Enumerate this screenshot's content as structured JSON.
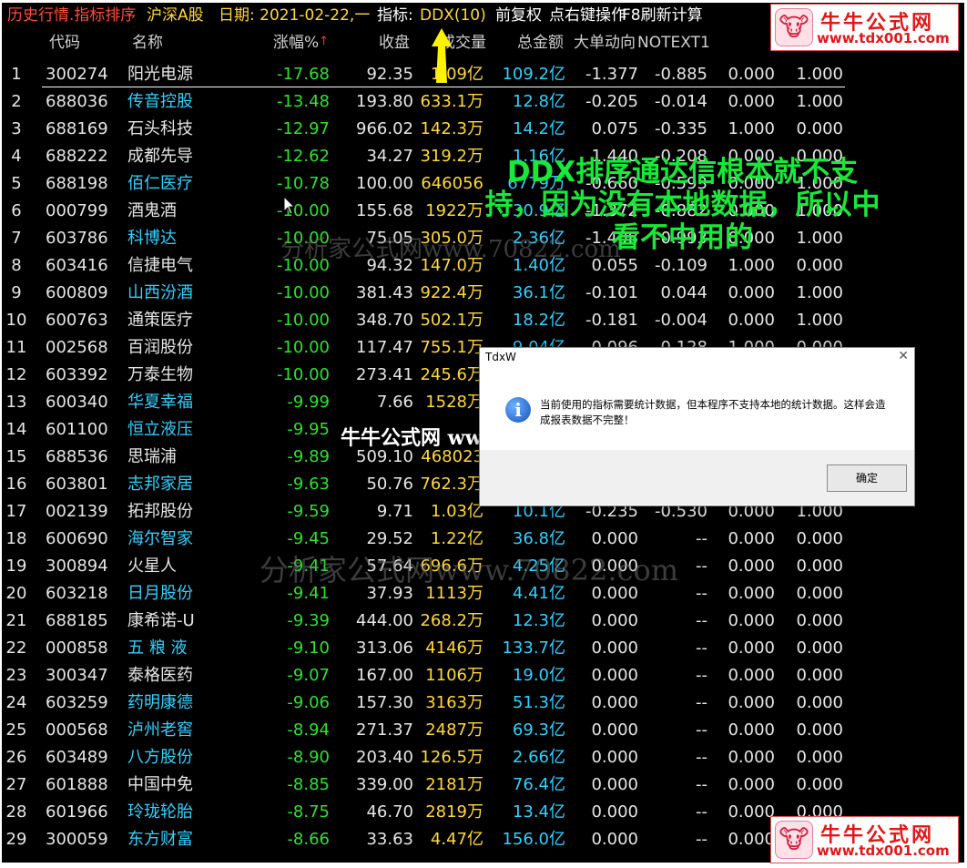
{
  "topbar": {
    "title": "历史行情.指标排序",
    "market": "沪深A股",
    "date": "日期: 2021-02-22,一",
    "indicator_label": "指标:",
    "indicator_value": "DDX(10)",
    "adjust": "前复权",
    "hint": "点右键操作",
    "f8": "F8刷新计算"
  },
  "columns": [
    "代码",
    "名称",
    "涨幅%",
    "收盘",
    "成交量",
    "总金额",
    "大单动向",
    "NOTEXT1"
  ],
  "sort_indicator": "↑",
  "rows": [
    {
      "idx": "1",
      "code": "300274",
      "name": "阳光电源",
      "cyan": false,
      "chg": "-17.68",
      "close": "92.35",
      "vol": "1.09亿",
      "amt": "109.2亿",
      "dd": "-1.377",
      "nt": "-0.885",
      "x1": "0.000",
      "x2": "1.000"
    },
    {
      "idx": "2",
      "code": "688036",
      "name": "传音控股",
      "cyan": true,
      "chg": "-13.48",
      "close": "193.80",
      "vol": "633.1万",
      "amt": "12.8亿",
      "dd": "-0.205",
      "nt": "-0.014",
      "x1": "0.000",
      "x2": "1.000"
    },
    {
      "idx": "3",
      "code": "688169",
      "name": "石头科技",
      "cyan": false,
      "chg": "-12.97",
      "close": "966.02",
      "vol": "142.3万",
      "amt": "14.2亿",
      "dd": "0.075",
      "nt": "-0.335",
      "x1": "1.000",
      "x2": "0.000"
    },
    {
      "idx": "4",
      "code": "688222",
      "name": "成都先导",
      "cyan": false,
      "chg": "-12.62",
      "close": "34.27",
      "vol": "319.2万",
      "amt": "1.16亿",
      "dd": "1.440",
      "nt": "-0.208",
      "x1": "0.000",
      "x2": "0.000"
    },
    {
      "idx": "5",
      "code": "688198",
      "name": "佰仁医疗",
      "cyan": true,
      "chg": "-10.78",
      "close": "100.00",
      "vol": "646056",
      "amt": "6779万",
      "dd": "-0.660",
      "nt": "-0.593",
      "x1": "0.000",
      "x2": "1.000"
    },
    {
      "idx": "6",
      "code": "000799",
      "name": "酒鬼酒",
      "cyan": false,
      "chg": "-10.00",
      "close": "155.68",
      "vol": "1922万",
      "amt": "30.9亿",
      "dd": "-1.372",
      "nt": "-0.882",
      "x1": "0.000",
      "x2": "1.000"
    },
    {
      "idx": "7",
      "code": "603786",
      "name": "科博达",
      "cyan": true,
      "chg": "-10.00",
      "close": "75.05",
      "vol": "305.0万",
      "amt": "2.36亿",
      "dd": "-1.408",
      "nt": "-0.993",
      "x1": "0.000",
      "x2": "1.000"
    },
    {
      "idx": "8",
      "code": "603416",
      "name": "信捷电气",
      "cyan": false,
      "chg": "-10.00",
      "close": "94.32",
      "vol": "147.0万",
      "amt": "1.40亿",
      "dd": "0.055",
      "nt": "-0.109",
      "x1": "1.000",
      "x2": "0.000"
    },
    {
      "idx": "9",
      "code": "600809",
      "name": "山西汾酒",
      "cyan": true,
      "chg": "-10.00",
      "close": "381.43",
      "vol": "922.4万",
      "amt": "36.1亿",
      "dd": "-0.101",
      "nt": "0.044",
      "x1": "0.000",
      "x2": "1.000"
    },
    {
      "idx": "10",
      "code": "600763",
      "name": "通策医疗",
      "cyan": false,
      "chg": "-10.00",
      "close": "348.70",
      "vol": "502.1万",
      "amt": "18.2亿",
      "dd": "-0.181",
      "nt": "-0.004",
      "x1": "0.000",
      "x2": "1.000"
    },
    {
      "idx": "11",
      "code": "002568",
      "name": "百润股份",
      "cyan": false,
      "chg": "-10.00",
      "close": "117.47",
      "vol": "755.1万",
      "amt": "9.04亿",
      "dd": "-0.096",
      "nt": "-0.128",
      "x1": "1.000",
      "x2": "0.000"
    },
    {
      "idx": "12",
      "code": "603392",
      "name": "万泰生物",
      "cyan": false,
      "chg": "-10.00",
      "close": "273.41",
      "vol": "245.6万",
      "amt": "",
      "dd": "",
      "nt": "",
      "x1": "",
      "x2": ""
    },
    {
      "idx": "13",
      "code": "600340",
      "name": "华夏幸福",
      "cyan": true,
      "chg": "-9.99",
      "close": "7.66",
      "vol": "1528万",
      "amt": "",
      "dd": "",
      "nt": "",
      "x1": "",
      "x2": ""
    },
    {
      "idx": "14",
      "code": "601100",
      "name": "恒立液压",
      "cyan": true,
      "chg": "-9.95",
      "close": "",
      "vol": "",
      "amt": "",
      "dd": "",
      "nt": "",
      "x1": "",
      "x2": ""
    },
    {
      "idx": "15",
      "code": "688536",
      "name": "思瑞浦",
      "cyan": false,
      "chg": "-9.89",
      "close": "509.10",
      "vol": "468023",
      "amt": "",
      "dd": "",
      "nt": "",
      "x1": "",
      "x2": ""
    },
    {
      "idx": "16",
      "code": "603801",
      "name": "志邦家居",
      "cyan": true,
      "chg": "-9.63",
      "close": "50.76",
      "vol": "762.3万",
      "amt": "",
      "dd": "",
      "nt": "",
      "x1": "",
      "x2": ""
    },
    {
      "idx": "17",
      "code": "002139",
      "name": "拓邦股份",
      "cyan": false,
      "chg": "-9.59",
      "close": "9.71",
      "vol": "1.03亿",
      "amt": "10.1亿",
      "dd": "-0.235",
      "nt": "-0.530",
      "x1": "0.000",
      "x2": "1.000"
    },
    {
      "idx": "18",
      "code": "600690",
      "name": "海尔智家",
      "cyan": true,
      "chg": "-9.45",
      "close": "29.52",
      "vol": "1.22亿",
      "amt": "36.8亿",
      "dd": "0.000",
      "nt": "--",
      "x1": "0.000",
      "x2": "0.000"
    },
    {
      "idx": "19",
      "code": "300894",
      "name": "火星人",
      "cyan": false,
      "chg": "-9.41",
      "close": "57.64",
      "vol": "696.6万",
      "amt": "4.25亿",
      "dd": "0.000",
      "nt": "--",
      "x1": "0.000",
      "x2": "0.000"
    },
    {
      "idx": "20",
      "code": "603218",
      "name": "日月股份",
      "cyan": true,
      "chg": "-9.41",
      "close": "37.93",
      "vol": "1113万",
      "amt": "4.41亿",
      "dd": "0.000",
      "nt": "--",
      "x1": "0.000",
      "x2": "0.000"
    },
    {
      "idx": "21",
      "code": "688185",
      "name": "康希诺-U",
      "cyan": false,
      "chg": "-9.39",
      "close": "444.00",
      "vol": "268.2万",
      "amt": "12.3亿",
      "dd": "0.000",
      "nt": "--",
      "x1": "0.000",
      "x2": "0.000"
    },
    {
      "idx": "22",
      "code": "000858",
      "name": "五 粮 液",
      "cyan": true,
      "chg": "-9.10",
      "close": "313.06",
      "vol": "4146万",
      "amt": "133.7亿",
      "dd": "0.000",
      "nt": "--",
      "x1": "0.000",
      "x2": "0.000"
    },
    {
      "idx": "23",
      "code": "300347",
      "name": "泰格医药",
      "cyan": false,
      "chg": "-9.07",
      "close": "167.00",
      "vol": "1106万",
      "amt": "19.0亿",
      "dd": "0.000",
      "nt": "--",
      "x1": "0.000",
      "x2": "0.000"
    },
    {
      "idx": "24",
      "code": "603259",
      "name": "药明康德",
      "cyan": true,
      "chg": "-9.06",
      "close": "157.30",
      "vol": "3163万",
      "amt": "51.3亿",
      "dd": "0.000",
      "nt": "--",
      "x1": "0.000",
      "x2": "0.000"
    },
    {
      "idx": "25",
      "code": "000568",
      "name": "泸州老窖",
      "cyan": true,
      "chg": "-8.94",
      "close": "271.37",
      "vol": "2487万",
      "amt": "69.3亿",
      "dd": "0.000",
      "nt": "--",
      "x1": "0.000",
      "x2": "0.000"
    },
    {
      "idx": "26",
      "code": "603489",
      "name": "八方股份",
      "cyan": true,
      "chg": "-8.90",
      "close": "203.40",
      "vol": "126.5万",
      "amt": "2.66亿",
      "dd": "0.000",
      "nt": "--",
      "x1": "0.000",
      "x2": "0.000"
    },
    {
      "idx": "27",
      "code": "601888",
      "name": "中国中免",
      "cyan": false,
      "chg": "-8.85",
      "close": "339.00",
      "vol": "2181万",
      "amt": "76.4亿",
      "dd": "0.000",
      "nt": "--",
      "x1": "0.000",
      "x2": "0.000"
    },
    {
      "idx": "28",
      "code": "601966",
      "name": "玲珑轮胎",
      "cyan": true,
      "chg": "-8.75",
      "close": "46.70",
      "vol": "2819万",
      "amt": "13.4亿",
      "dd": "0.000",
      "nt": "--",
      "x1": "0.000",
      "x2": "0.000"
    },
    {
      "idx": "29",
      "code": "300059",
      "name": "东方财富",
      "cyan": true,
      "chg": "-8.66",
      "close": "33.63",
      "vol": "4.47亿",
      "amt": "156.0亿",
      "dd": "0.000",
      "nt": "--",
      "x1": "0.000",
      "x2": "0.000"
    }
  ],
  "annotation": "DDX排序通达信根本就不支持，因为没有本地数据，所以中看不中用的",
  "watermarks": {
    "wm1": "分析家公式网www.70822.com",
    "wm2": "分析家公式网www.70822.com",
    "wm3": "牛牛公式网 www.tdx001.com"
  },
  "logo": {
    "name": "牛牛公式网",
    "url": "www.tdx001.com"
  },
  "dialog": {
    "title": "TdxW",
    "message": "当前使用的指标需要统计数据，但本程序不支持本地的统计数据。这样会造成报表数据不完整！",
    "ok": "确定"
  },
  "colors": {
    "background": "#000000",
    "negative_change": "#2de22d",
    "volume": "#ffd83d",
    "amount": "#33d0ff",
    "title": "#ff4a3a",
    "annotation": "#19e83a"
  }
}
